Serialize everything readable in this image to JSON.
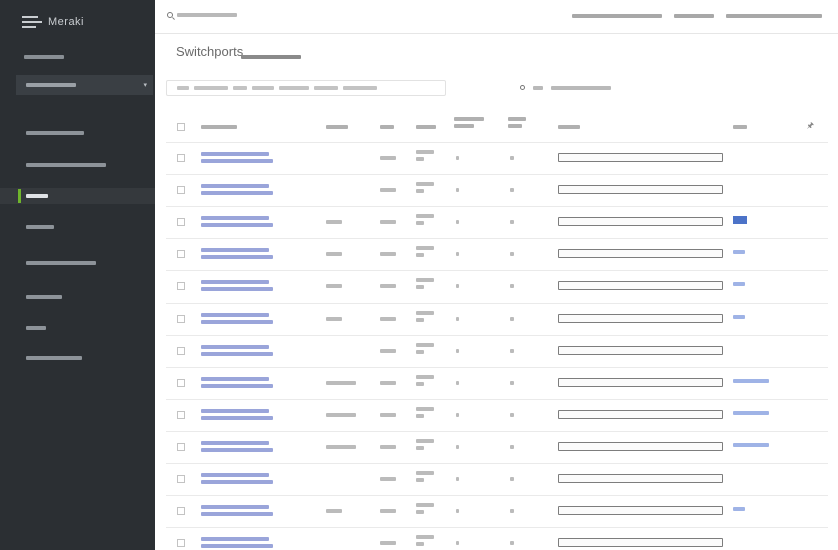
{
  "app": {
    "brand": "Meraki"
  },
  "page": {
    "title": "Switchports"
  },
  "colors": {
    "sidebar_bg": "#2b2f33",
    "active_accent": "#6fb52c",
    "link": "#4c73c8"
  },
  "icons": {
    "search": "search-icon",
    "settings": "gear-icon",
    "pin": "pin-icon",
    "dropdown": "chevron-down-icon"
  },
  "table": {
    "row_count": 13,
    "rows": [
      {
        "tag": "none"
      },
      {
        "tag": "none"
      },
      {
        "tag": "filled"
      },
      {
        "tag": "outline-short"
      },
      {
        "tag": "outline-short"
      },
      {
        "tag": "outline-short"
      },
      {
        "tag": "none"
      },
      {
        "tag": "outline-long"
      },
      {
        "tag": "outline-long"
      },
      {
        "tag": "outline-long"
      },
      {
        "tag": "none"
      },
      {
        "tag": "outline-short"
      },
      {
        "tag": "none"
      }
    ]
  }
}
